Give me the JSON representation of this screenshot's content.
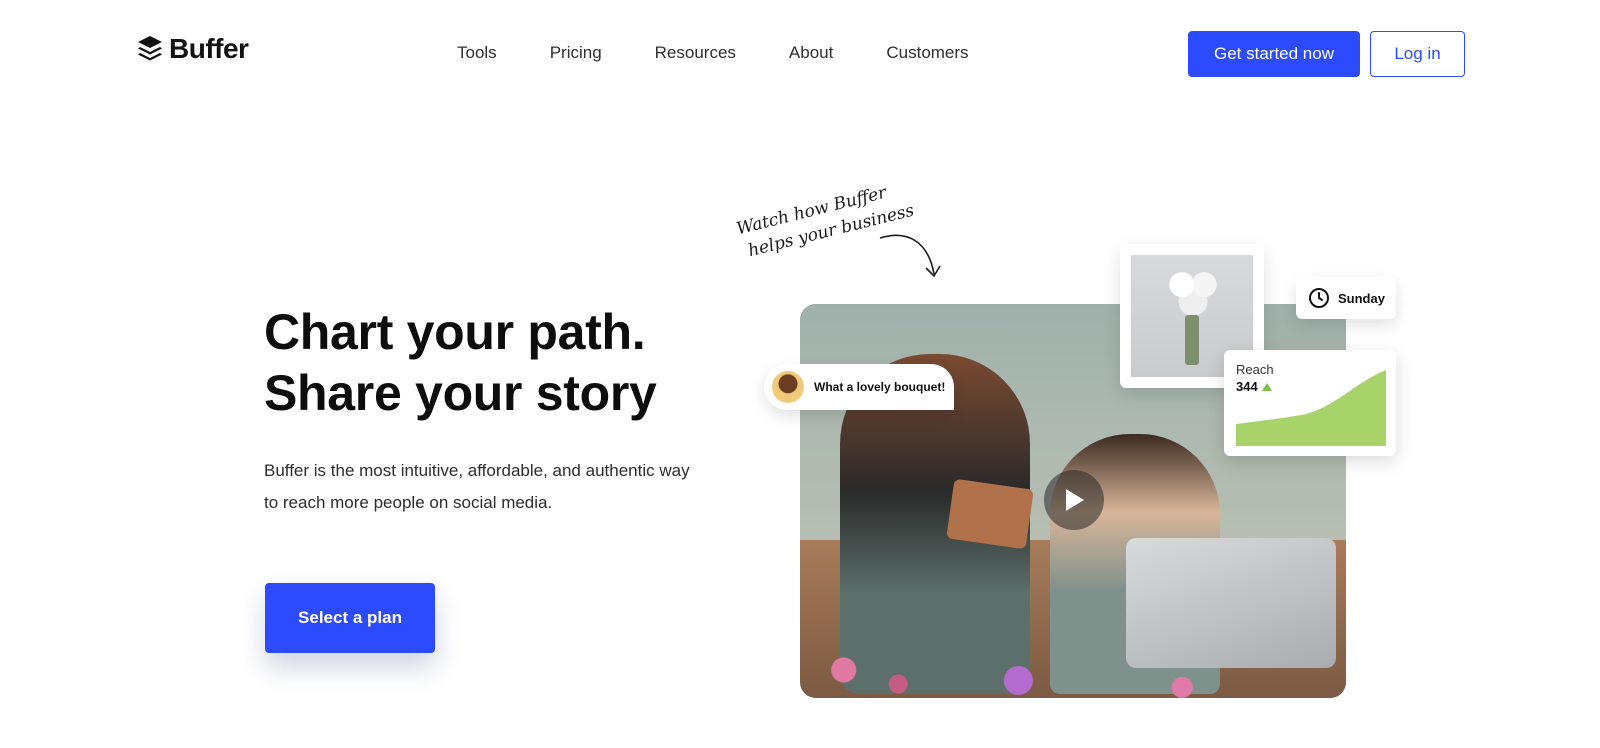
{
  "header": {
    "logo_text": "Buffer",
    "nav": [
      "Tools",
      "Pricing",
      "Resources",
      "About",
      "Customers"
    ],
    "cta_label": "Get started now",
    "login_label": "Log in"
  },
  "hero": {
    "headline_line1": "Chart your path.",
    "headline_line2": "Share your story",
    "description": "Buffer is the most intuitive, affordable, and authentic way to reach more people on social media.",
    "button_label": "Select a plan"
  },
  "media": {
    "annotation_line1": "Watch how Buffer",
    "annotation_line2": "helps your business",
    "chat_text": "What a lovely bouquet!",
    "day_label": "Sunday",
    "reach_label": "Reach",
    "reach_value": "344"
  },
  "colors": {
    "accent": "#2c4bff",
    "reach_fill": "#a8d36a"
  },
  "icons": [
    "buffer-logo-icon",
    "play-icon",
    "clock-icon",
    "trend-up-icon"
  ]
}
